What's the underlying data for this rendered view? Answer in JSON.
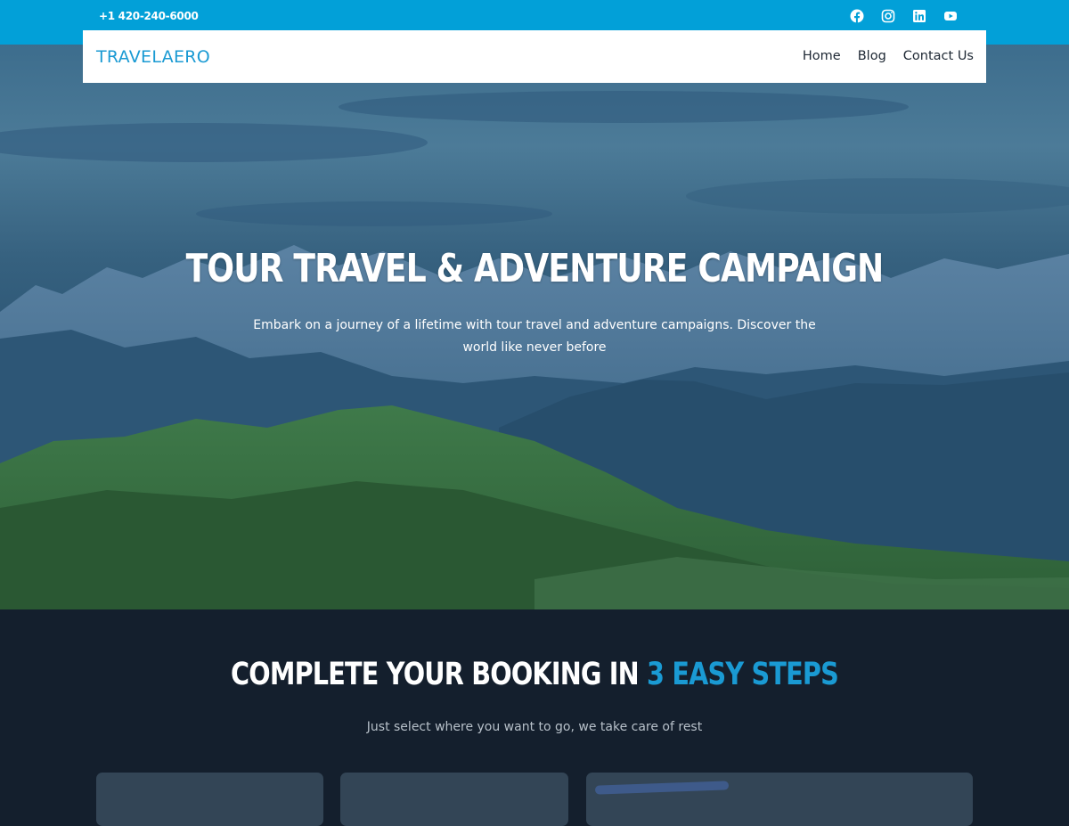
{
  "topbar": {
    "phone": "+1 420-240-6000",
    "socials": [
      "facebook-icon",
      "instagram-icon",
      "linkedin-icon",
      "youtube-icon"
    ],
    "background_color": "#02a0d8"
  },
  "navbar": {
    "logo": "TRAVELAERO",
    "logo_color": "#1a9ad3",
    "menu": [
      {
        "label": "Home"
      },
      {
        "label": "Blog"
      },
      {
        "label": "Contact Us"
      }
    ]
  },
  "hero": {
    "title": "TOUR TRAVEL & ADVENTURE CAMPAIGN",
    "subtitle": "Embark on a journey of a lifetime with tour travel and adventure campaigns. Discover the world like never before"
  },
  "steps": {
    "title_main": "COMPLETE YOUR BOOKING IN ",
    "title_accent": "3 EASY STEPS",
    "accent_color": "#1a9ad3",
    "subtitle": "Just select where you want to go, we take care of rest"
  }
}
